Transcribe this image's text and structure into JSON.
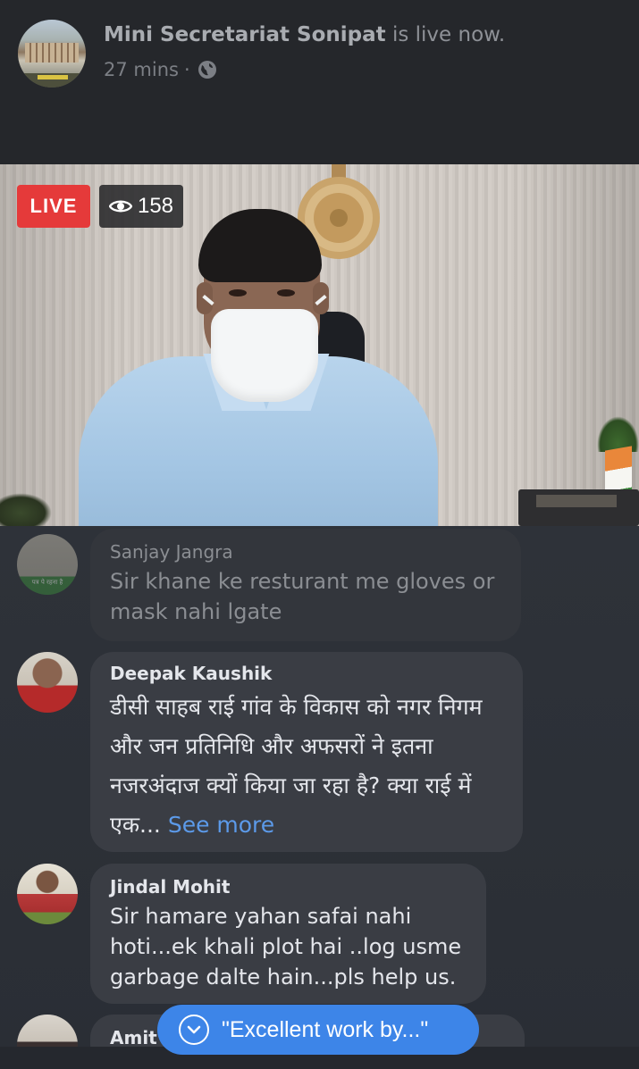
{
  "post": {
    "page_name": "Mini Secretariat Sonipat",
    "status_text": "is live now.",
    "time_ago": "27 mins",
    "separator": "·",
    "privacy_icon": "globe-icon"
  },
  "video": {
    "live_label": "LIVE",
    "viewer_count": "158",
    "viewer_icon": "eye-icon"
  },
  "comments": [
    {
      "name": "Sanjay Jangra",
      "text": "Sir khane ke resturant me gloves or mask nahi lgate",
      "faded": true,
      "avatar_caption": "पत्र पे रहना है"
    },
    {
      "name": "Deepak Kaushik",
      "text": "डीसी साहब राई गांव के विकास को नगर निगम और जन प्रतिनिधि और अफसरों ने इतना नजरअंदाज क्यों किया जा रहा है? क्या राई में एक...",
      "see_more": "See more"
    },
    {
      "name": "Jindal Mohit",
      "text": "Sir hamare yahan safai nahi hoti...ek khali plot hai ..log usme garbage dalte hain...pls help us."
    },
    {
      "name": "Amit"
    }
  ],
  "new_comment_pill": {
    "text": "\"Excellent work by...\"",
    "icon": "chevron-down-icon"
  },
  "colors": {
    "live_red": "#e53a3a",
    "accent_blue": "#3d85e8",
    "link_blue": "#5c9ae9"
  }
}
